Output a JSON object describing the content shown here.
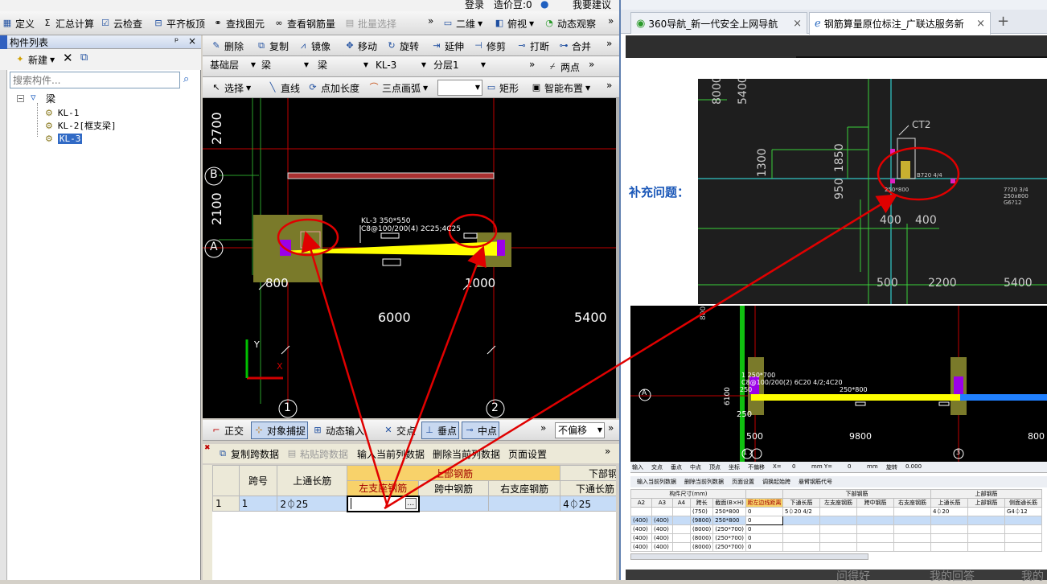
{
  "left_app": {
    "top_strip": {
      "login": "登录",
      "price_bean": "造价豆:0",
      "suggest": "我要建议"
    },
    "main_toolbar": {
      "define": "定义",
      "sum_calc": "汇总计算",
      "cloud_check": "云检查",
      "flush_slab": "平齐板顶",
      "find_elem": "查找图元",
      "view_rebar": "查看钢筋量",
      "batch_select": "批量选择",
      "dim_mode": "二维",
      "view_mode": "俯视",
      "dynamic_view": "动态观察"
    },
    "component_panel": {
      "title": "构件列表",
      "pin": "ᵖ",
      "new_btn": "新建",
      "search_placeholder": "搜索构件...",
      "tree_root": "梁",
      "items": [
        {
          "label": "KL-1"
        },
        {
          "label": "KL-2[框支梁]"
        },
        {
          "label": "KL-3"
        }
      ]
    },
    "edit_toolbar": {
      "delete": "删除",
      "copy": "复制",
      "mirror": "镜像",
      "move": "移动",
      "rotate": "旋转",
      "extend": "延伸",
      "trim": "修剪",
      "break": "打断",
      "merge": "合并"
    },
    "layer_toolbar": {
      "layer": "基础层",
      "cat1": "梁",
      "cat2": "梁",
      "comp": "KL-3",
      "floor": "分层1",
      "two_point": "两点"
    },
    "draw_toolbar": {
      "select": "选择",
      "line": "直线",
      "add_length": "点加长度",
      "arc3": "三点画弧",
      "rect": "矩形",
      "smart_layout": "智能布置"
    },
    "cad": {
      "dim_top": "2700",
      "dim_mid": "2100",
      "axis_b": "B",
      "axis_a": "A",
      "beam_label_1": "KL-3 350*550",
      "beam_label_2": "C8@100/200(4) 2C25;4C25",
      "dim_800": "800",
      "dim_1000": "1000",
      "dim_6000": "6000",
      "dim_5400": "5400",
      "axis_1": "1",
      "axis_2": "2",
      "ucs_y": "Y",
      "ucs_x": "X"
    },
    "snap_bar": {
      "ortho": "正交",
      "obj_snap": "对象捕捉",
      "dyn_input": "动态输入",
      "intersect": "交点",
      "perp": "垂点",
      "mid": "中点",
      "no_offset": "不偏移"
    },
    "table_toolbar": {
      "copy_span": "复制跨数据",
      "paste_span": "粘贴跨数据",
      "input_col": "输入当前列数据",
      "delete_col": "删除当前列数据",
      "page_setup": "页面设置"
    },
    "table": {
      "headers": {
        "span_no": "跨号",
        "top_long": "上通长筋",
        "top_rebar": "上部钢筋",
        "bottom_rebar": "下部钢筋",
        "left_support": "左支座钢筋",
        "mid_span": "跨中钢筋",
        "right_support": "右支座钢筋",
        "bottom_long": "下通长筋"
      },
      "row": {
        "idx": "1",
        "span": "1",
        "top_long": "2⏀25",
        "bottom_long": "4⏀25"
      }
    }
  },
  "browser": {
    "tabs": [
      {
        "label": "360导航_新一代安全上网导航"
      },
      {
        "label": "钢筋算量原位标注_广联达服务新"
      }
    ],
    "new_tab": "+",
    "close": "×",
    "supplement_label": "补充问题：",
    "cad_top": {
      "dim_8000": "8000",
      "dim_5400": "5400",
      "ct2": "CT2",
      "dim_1850": "1850",
      "dim_1300": "1300",
      "dim_950": "950",
      "dim_400a": "400",
      "dim_400b": "400",
      "dim_500": "500",
      "dim_2200": "2200",
      "dim_5400b": "5400",
      "note_a": "250*800",
      "note_b": "B720 4/4",
      "note_c": "7?20 3/4",
      "note_d": "250x800",
      "note_e": "G6?12"
    },
    "cad_bottom": {
      "dim_800": "800",
      "axis_a": "A",
      "label_1": "1 250*700",
      "label_2": "C8@100/200(2) 6C20 4/2;4C20",
      "label_3": "250*800",
      "dim_250a": "250",
      "dim_250b": "250",
      "dim_6100": "6100",
      "dim_500": "500",
      "dim_9800": "9800",
      "dim_800b": "800",
      "axis_12": "1 2",
      "axis_3": "3"
    },
    "mini_toolbar": {
      "items": [
        "输入",
        "交点",
        "垂点",
        "中点",
        "顶点",
        "坐标",
        "不偏移",
        "X=",
        "0",
        "mm Y=",
        "0",
        "mm",
        "旋转",
        "0.000"
      ]
    },
    "mini_toolbar2": {
      "items": [
        "输入当前列数据",
        "删除当前列数据",
        "页面设置",
        "调换起始跨",
        "悬臂钢筋代号"
      ]
    },
    "mini_table": {
      "headers": [
        "A2",
        "A3",
        "A4",
        "跨长",
        "截面(B×H)",
        "距左边线距离",
        "下通长筋",
        "左支座钢筋",
        "跨中钢筋",
        "右支座钢筋",
        "上通长筋",
        "上部钢筋",
        "侧面通长筋"
      ],
      "group_headers": [
        "构件尺寸(mm)",
        "下部钢筋",
        "上部钢筋"
      ],
      "rows": [
        [
          "",
          "",
          "",
          "(750)",
          "250*800",
          "0",
          "5⏀20 4/2",
          "",
          "",
          "",
          "4⏀20",
          "",
          "G4⏀12"
        ],
        [
          "(400)",
          "(400)",
          "",
          "(9800)",
          "250*800",
          "0",
          "",
          "",
          "",
          "",
          "",
          "",
          ""
        ],
        [
          "(400)",
          "(400)",
          "",
          "(8000)",
          "(250*700)",
          "0",
          "",
          "",
          "",
          "",
          "",
          "",
          ""
        ],
        [
          "(400)",
          "(400)",
          "",
          "(8000)",
          "(250*700)",
          "0",
          "",
          "",
          "",
          "",
          "",
          "",
          ""
        ],
        [
          "(400)",
          "(400)",
          "",
          "(8000)",
          "(250*700)",
          "0",
          "",
          "",
          "",
          "",
          "",
          "",
          ""
        ]
      ]
    },
    "bottom_strip": [
      "问得好",
      "我的回答",
      "我的"
    ],
    "accent": "#1a57b8"
  },
  "colors": {
    "cad_bg": "#000000",
    "beam_yellow": "#ffff00",
    "annot_red": "#e00000",
    "purple": "#9b00e8",
    "olive": "#8a8a2a"
  }
}
